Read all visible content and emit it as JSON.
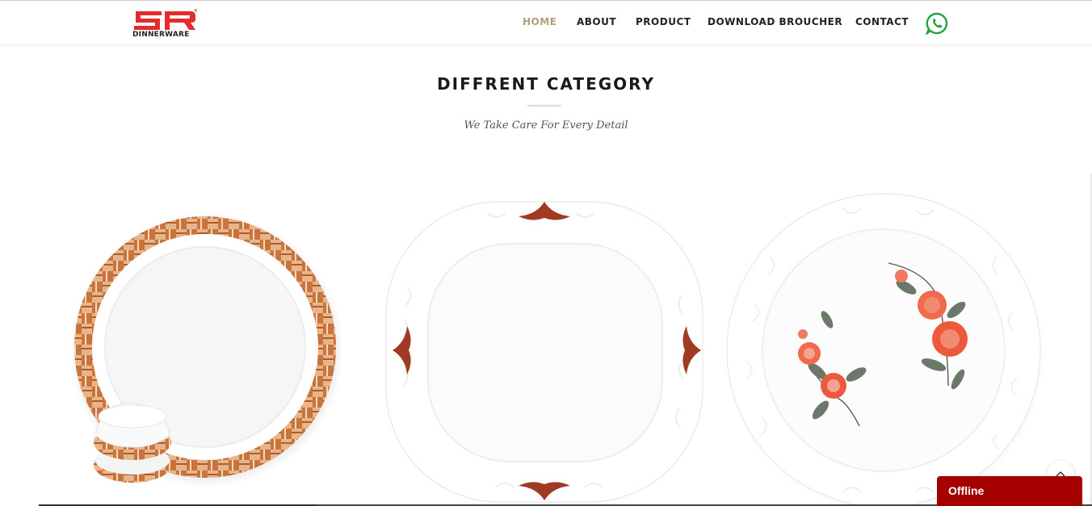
{
  "brand": {
    "logo_letters": "SR",
    "name": "DINNERWARE",
    "registered_mark": "®"
  },
  "nav": {
    "items": [
      {
        "label": "HOME",
        "active": true
      },
      {
        "label": "ABOUT",
        "active": false
      },
      {
        "label": "PRODUCT",
        "active": false
      },
      {
        "label": "DOWNLOAD BROUCHER",
        "active": false
      },
      {
        "label": "CONTACT",
        "active": false
      }
    ],
    "whatsapp_icon": "whatsapp-icon"
  },
  "section": {
    "title": "DIFFRENT CATEGORY",
    "subtitle": "We Take Care For Every Detail"
  },
  "products": [
    {
      "name": "wood-pattern-round-plate-with-bowls"
    },
    {
      "name": "square-ornament-plate"
    },
    {
      "name": "floral-rose-round-plate"
    }
  ],
  "chat": {
    "status": "Offline"
  },
  "colors": {
    "accent": "#b59d76",
    "nav_text": "#222222",
    "chat_bg": "#a50000",
    "whatsapp": "#25a244",
    "logo_red": "#e52b2b"
  }
}
